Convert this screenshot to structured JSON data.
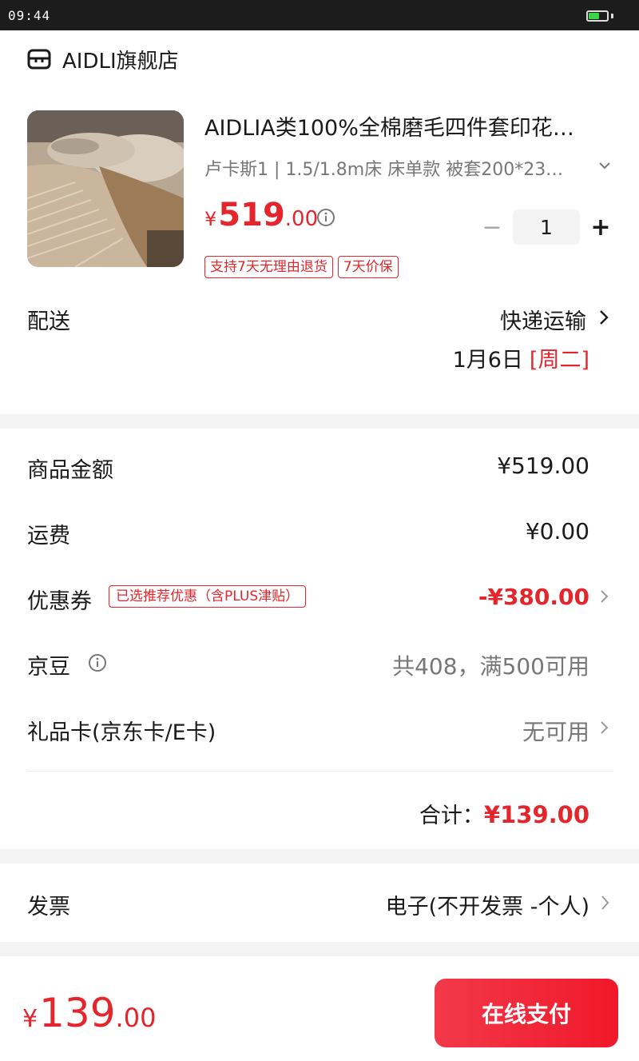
{
  "status_bar": {
    "time": "09:44",
    "battery_level": 0.6
  },
  "shop": {
    "name": "AIDLI旗舰店",
    "icon": "store-icon"
  },
  "product": {
    "title": "AIDLIA类100%全棉磨毛四件套印花…",
    "spec": "卢卡斯1 | 1.5/1.8m床 床单款 被套200*23…",
    "price_symbol": "¥",
    "price_int": "519",
    "price_dec": ".00",
    "quantity": "1",
    "minus": "−",
    "plus": "+",
    "tags": [
      "支持7天无理由退货",
      "7天价保"
    ]
  },
  "delivery": {
    "label": "配送",
    "method": "快递运输",
    "date": "1月6日",
    "weekday": "[周二]"
  },
  "pricing": {
    "goods_label": "商品金额",
    "goods_value": "¥519.00",
    "shipping_label": "运费",
    "shipping_value": "¥0.00",
    "coupon_label": "优惠券",
    "coupon_badge": "已选推荐优惠（含PLUS津贴）",
    "coupon_value": "-¥380.00",
    "beans_label": "京豆",
    "beans_value": "共408，满500可用",
    "giftcard_label": "礼品卡(京东卡/E卡)",
    "giftcard_value": "无可用",
    "total_label": "合计：",
    "total_value": "¥139.00"
  },
  "invoice": {
    "label": "发票",
    "value": "电子(不开发票 -个人)"
  },
  "bottom": {
    "price_symbol": "¥",
    "price_int": "139",
    "price_dec": ".00",
    "pay_label": "在线支付"
  },
  "colors": {
    "accent": "#e4252c",
    "background": "#f3f3f3"
  }
}
